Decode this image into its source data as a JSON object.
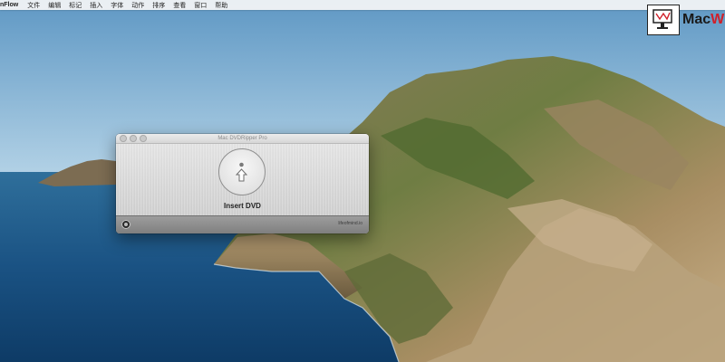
{
  "menubar": {
    "app_name": "nFlow",
    "items": [
      "文件",
      "编辑",
      "标记",
      "插入",
      "字体",
      "动作",
      "排序",
      "查看",
      "窗口",
      "帮助"
    ]
  },
  "watermark": {
    "text_main": "Mac",
    "text_accent": "W"
  },
  "window": {
    "title": "Mac DVDRipper Pro",
    "insert_label": "Insert DVD",
    "site_label": "lifeofmind.io"
  },
  "colors": {
    "sky": "#9cc2df",
    "sea": "#184f80",
    "land": "#7f8a52",
    "cliff": "#b2956b",
    "menubar_bg": "#f6f6f6",
    "window_bg": "#d9d9d9",
    "bottom_bar": "#8f8f8f"
  },
  "icons": {
    "traffic_lights": "window-controls",
    "disc": "disc-icon",
    "eject_arrow": "arrow-up-icon",
    "settings": "settings-icon"
  }
}
